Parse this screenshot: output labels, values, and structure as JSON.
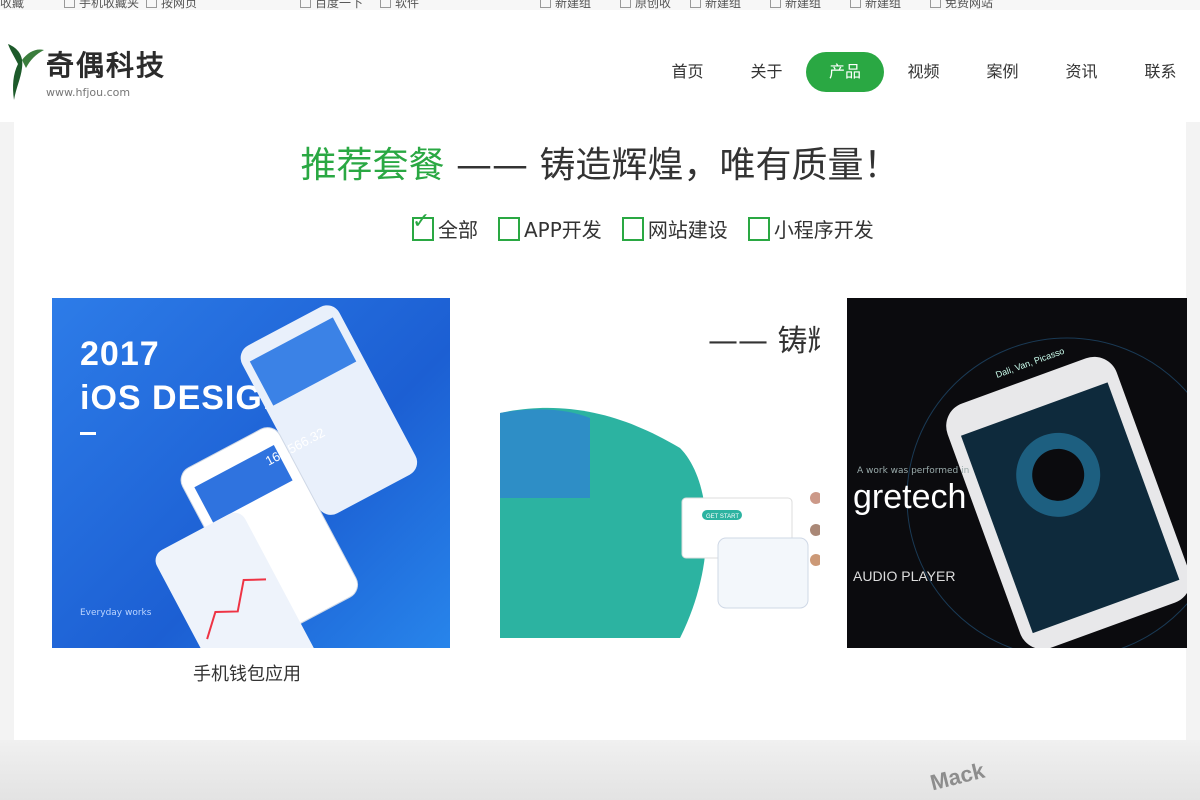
{
  "bookmarks": [
    {
      "label": "收藏"
    },
    {
      "label": "手机收藏夹"
    },
    {
      "label": "按网页"
    },
    {
      "label": "百度一下"
    },
    {
      "label": "软件"
    },
    {
      "label": "新建组"
    },
    {
      "label": "原创收"
    },
    {
      "label": "新建组"
    },
    {
      "label": "新建组"
    },
    {
      "label": "新建组"
    },
    {
      "label": "免费网站"
    }
  ],
  "logo": {
    "title": "奇偶科技",
    "url": "www.hfjou.com"
  },
  "nav": [
    "首页",
    "关于",
    "产品",
    "视频",
    "案例",
    "资讯",
    "联系"
  ],
  "heading": {
    "green": "推荐套餐",
    "rest": " —— 铸造辉煌，唯有质量！"
  },
  "filters": [
    {
      "label": "全部",
      "checked": true
    },
    {
      "label": "APP开发",
      "checked": false
    },
    {
      "label": "网站建设",
      "checked": false
    },
    {
      "label": "小程序开发",
      "checked": false
    }
  ],
  "card1": {
    "line1": "2017",
    "line2": "iOS DESIGN",
    "foot": "Everyday works",
    "caption": "手机钱包应用",
    "amount": "160,566.32"
  },
  "card2": {
    "overlay": "—— 铸辉煌",
    "button": "GET START"
  },
  "card3": {
    "brand": "gretech",
    "small": "A work was performed in",
    "audio": "AUDIO PLAYER",
    "song": "Dali, Van, Picasso"
  },
  "bottom": {
    "mack": "Mack"
  },
  "colors": {
    "accent": "#2aa843",
    "card1": "#1c5fd3",
    "card3": "#0b0b0e"
  }
}
